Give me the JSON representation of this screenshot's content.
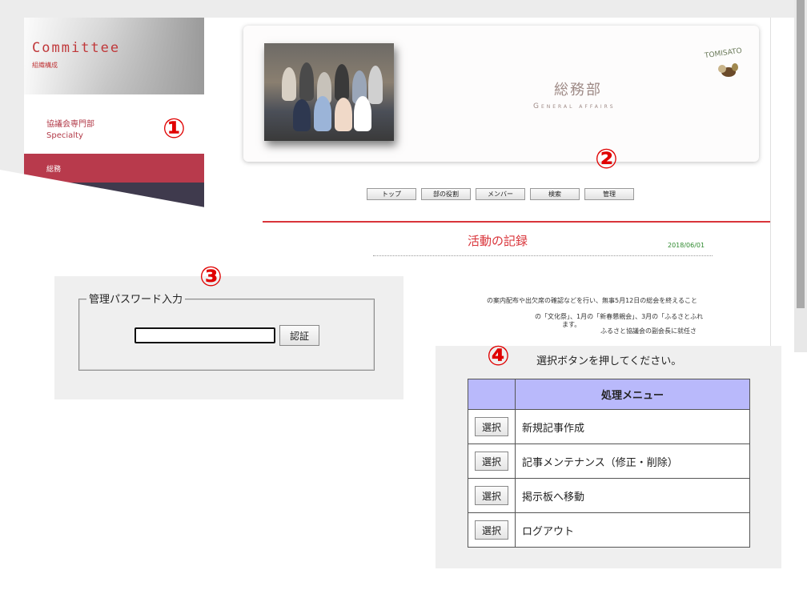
{
  "sidebar": {
    "title": "Committee",
    "subtitle": "組織構成",
    "section_jp": "協議会専門部",
    "section_en": "Specialty",
    "active_item": "総務"
  },
  "site": {
    "department_jp": "総務部",
    "department_en": "General affairs",
    "logo_text": "TOMISATO",
    "nav": [
      "トップ",
      "部の役割",
      "メンバー",
      "検索",
      "管理"
    ],
    "section_title": "活動の記録",
    "post_date": "2018/06/01",
    "body_lines": [
      "の案内配布や出欠席の確認などを行い、無事5月12日の総会を終えること",
      "の「文化祭」、1月の「新春懇親会」、3月の「ふるさとふれ",
      "ます。",
      "ふるさと協議会の副会長に就任さ"
    ]
  },
  "password": {
    "legend": "管理パスワード入力",
    "submit_label": "認証",
    "value": ""
  },
  "menu": {
    "prompt": "選択ボタンを押してください。",
    "header": "処理メニュー",
    "select_label": "選択",
    "items": [
      "新規記事作成",
      "記事メンテナンス（修正・削除）",
      "掲示板へ移動",
      "ログアウト"
    ]
  },
  "annotations": [
    "①",
    "②",
    "③",
    "④"
  ],
  "colors": {
    "accent_red": "#d9343a",
    "sidebar_active": "#b83a4c",
    "menu_header": "#b9b9fb",
    "annotation": "#e00000"
  }
}
